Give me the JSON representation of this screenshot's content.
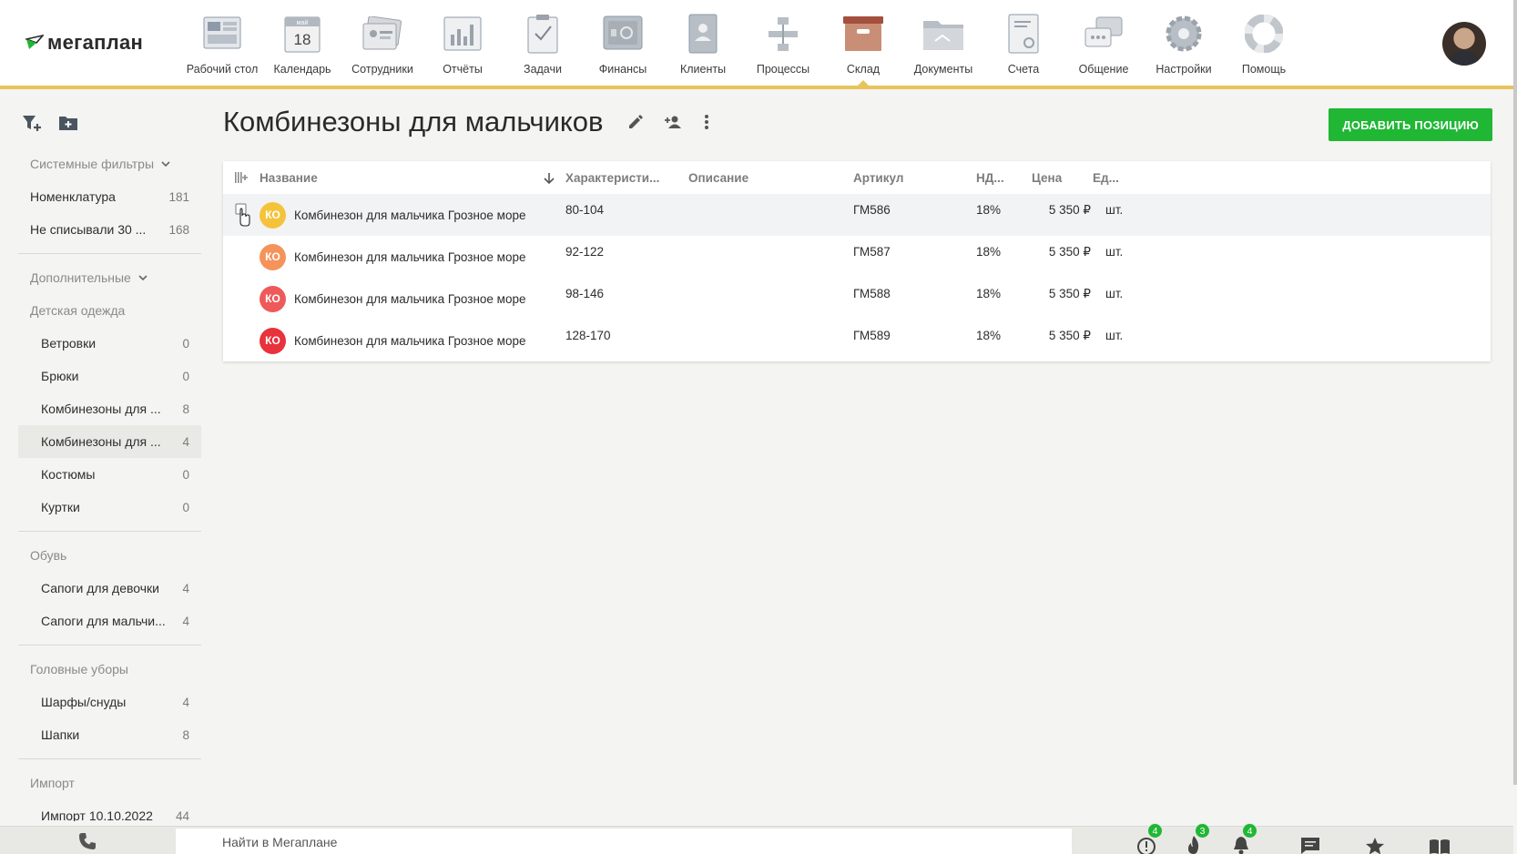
{
  "app": {
    "logo_text": "мегаплан"
  },
  "nav": [
    {
      "label": "Рабочий стол",
      "icon": "desktop-icon"
    },
    {
      "label": "Календарь",
      "icon": "calendar-icon",
      "cal_month": "май",
      "cal_day": "18"
    },
    {
      "label": "Сотрудники",
      "icon": "employees-icon"
    },
    {
      "label": "Отчёты",
      "icon": "reports-icon"
    },
    {
      "label": "Задачи",
      "icon": "tasks-icon"
    },
    {
      "label": "Финансы",
      "icon": "finance-icon"
    },
    {
      "label": "Клиенты",
      "icon": "clients-icon"
    },
    {
      "label": "Процессы",
      "icon": "processes-icon"
    },
    {
      "label": "Склад",
      "icon": "warehouse-icon",
      "active": true
    },
    {
      "label": "Документы",
      "icon": "documents-icon"
    },
    {
      "label": "Счета",
      "icon": "invoices-icon"
    },
    {
      "label": "Общение",
      "icon": "chat-icon"
    },
    {
      "label": "Настройки",
      "icon": "settings-icon"
    },
    {
      "label": "Помощь",
      "icon": "help-icon"
    }
  ],
  "sidebar": {
    "system_filters_label": "Системные фильтры",
    "system_items": [
      {
        "label": "Номенклатура",
        "count": "181"
      },
      {
        "label": "Не списывали 30 ...",
        "count": "168"
      }
    ],
    "additional_label": "Дополнительные",
    "kids_clothes_label": "Детская одежда",
    "kids_items": [
      {
        "label": "Ветровки",
        "count": "0"
      },
      {
        "label": "Брюки",
        "count": "0"
      },
      {
        "label": "Комбинезоны для ...",
        "count": "8"
      },
      {
        "label": "Комбинезоны для ...",
        "count": "4",
        "active": true
      },
      {
        "label": "Костюмы",
        "count": "0"
      },
      {
        "label": "Куртки",
        "count": "0"
      }
    ],
    "shoes_label": "Обувь",
    "shoes_items": [
      {
        "label": "Сапоги для девочки",
        "count": "4"
      },
      {
        "label": "Сапоги для мальчи...",
        "count": "4"
      }
    ],
    "hats_label": "Головные уборы",
    "hats_items": [
      {
        "label": "Шарфы/снуды",
        "count": "4"
      },
      {
        "label": "Шапки",
        "count": "8"
      }
    ],
    "import_label": "Импорт",
    "import_items": [
      {
        "label": "Импорт 10.10.2022",
        "count": "44"
      }
    ]
  },
  "page": {
    "title": "Комбинезоны для мальчиков",
    "add_button": "ДОБАВИТЬ ПОЗИЦИЮ"
  },
  "table": {
    "headers": {
      "name": "Название",
      "char": "Характеристи...",
      "desc": "Описание",
      "art": "Артикул",
      "nds": "НД...",
      "price": "Цена",
      "unit": "Ед..."
    },
    "rows": [
      {
        "badge": "КО",
        "badge_color": "#f5c33b",
        "name": "Комбинезон для мальчика Грозное море",
        "char": "80-104",
        "desc": "",
        "art": "ГМ586",
        "nds": "18%",
        "price": "5 350 ₽",
        "unit": "шт."
      },
      {
        "badge": "КО",
        "badge_color": "#f5935a",
        "name": "Комбинезон для мальчика Грозное море",
        "char": "92-122",
        "desc": "",
        "art": "ГМ587",
        "nds": "18%",
        "price": "5 350 ₽",
        "unit": "шт."
      },
      {
        "badge": "КО",
        "badge_color": "#ee5a5a",
        "name": "Комбинезон для мальчика Грозное море",
        "char": "98-146",
        "desc": "",
        "art": "ГМ588",
        "nds": "18%",
        "price": "5 350 ₽",
        "unit": "шт."
      },
      {
        "badge": "КО",
        "badge_color": "#e8323c",
        "name": "Комбинезон для мальчика Грозное море",
        "char": "128-170",
        "desc": "",
        "art": "ГМ589",
        "nds": "18%",
        "price": "5 350 ₽",
        "unit": "шт."
      }
    ]
  },
  "bottombar": {
    "search_placeholder": "Найти в Мегаплане",
    "badges": {
      "alerts": "4",
      "hot": "3",
      "notifications": "4"
    }
  },
  "colors": {
    "accent_yellow": "#e8c35b",
    "primary_green": "#1fb734"
  }
}
